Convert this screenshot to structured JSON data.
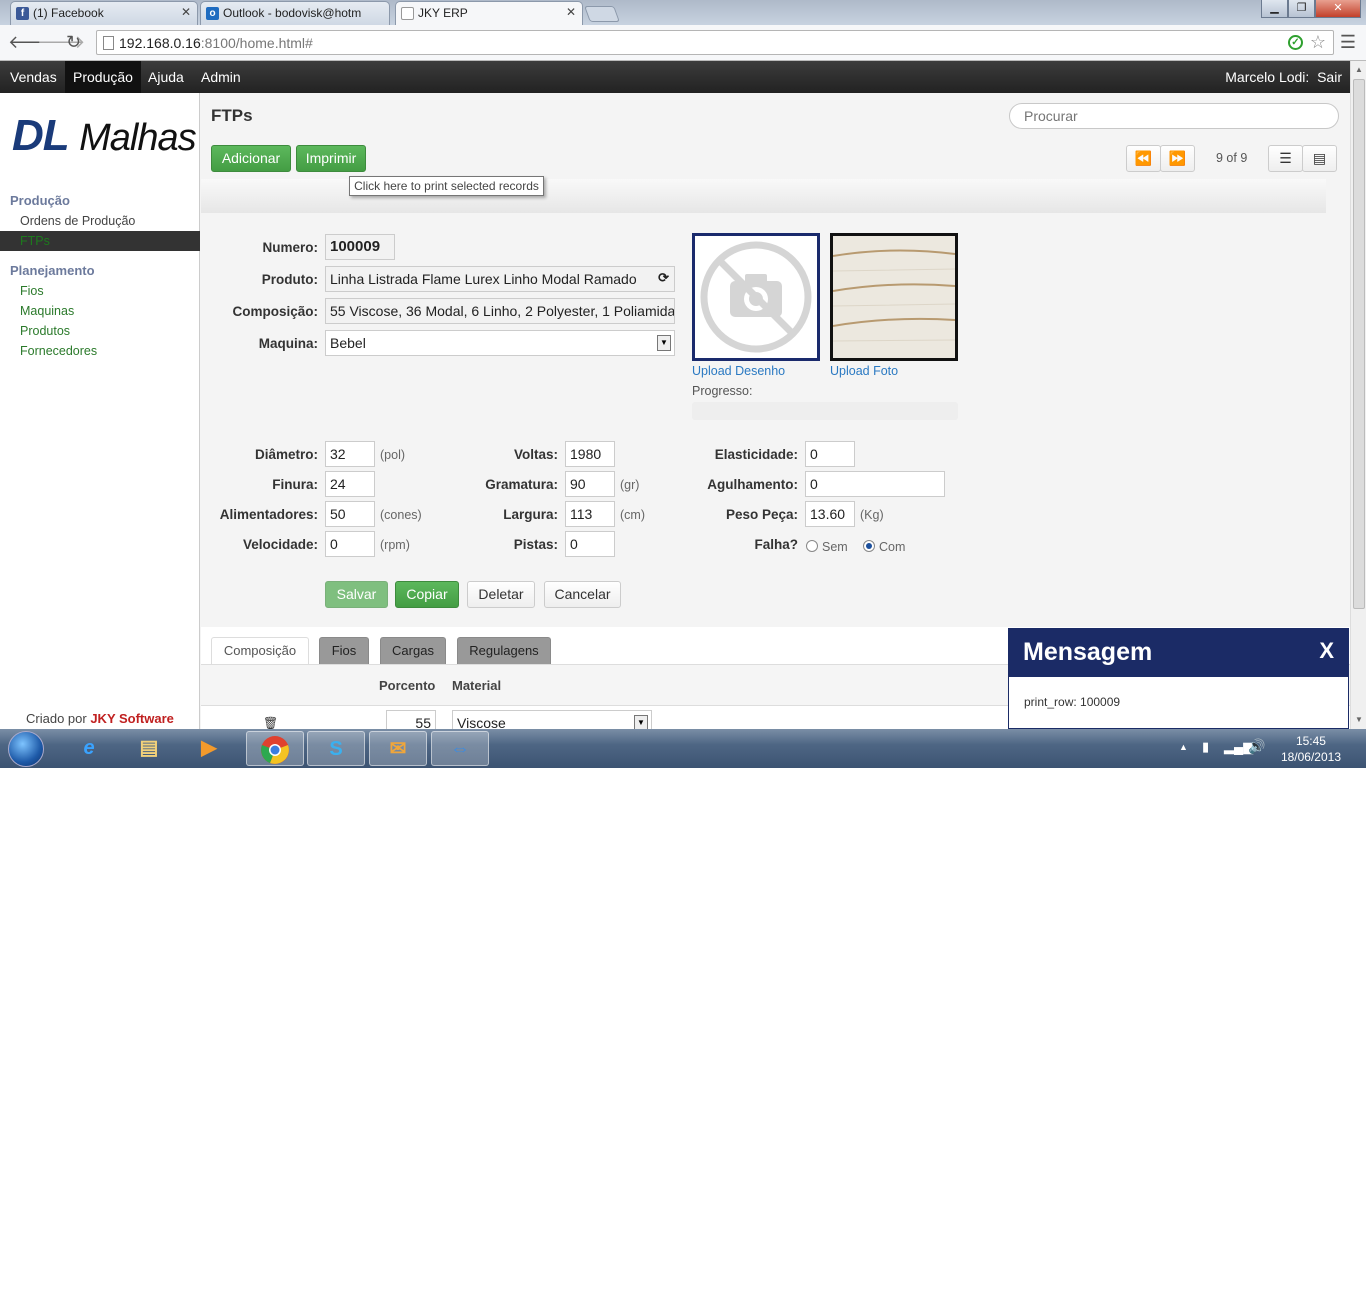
{
  "browser": {
    "tabs": [
      {
        "title": "(1) Facebook",
        "active": false
      },
      {
        "title": "Outlook - bodovisk@hotm",
        "active": false
      },
      {
        "title": "JKY ERP",
        "active": true
      }
    ],
    "url_host": "192.168.0.16",
    "url_rest": ":8100/home.html#"
  },
  "app_nav": {
    "menu": [
      "Vendas",
      "Produção",
      "Ajuda",
      "Admin"
    ],
    "active": "Produção",
    "user": "Marcelo Lodi:",
    "logout": "Sair"
  },
  "sidebar": {
    "logo_dl": "DL",
    "logo_malhas": "Malhas",
    "sections": [
      {
        "heading": "Produção",
        "items": [
          "Ordens de Produção",
          "FTPs"
        ]
      },
      {
        "heading": "Planejamento",
        "items": [
          "Fios",
          "Maquinas",
          "Produtos",
          "Fornecedores"
        ]
      }
    ],
    "active_item": "FTPs",
    "credit_prefix": "Criado por",
    "credit_brand": "JKY Software"
  },
  "page": {
    "title": "FTPs",
    "search_placeholder": "Procurar",
    "add_label": "Adicionar",
    "print_label": "Imprimir",
    "tooltip": "Click here to print selected records",
    "pager": "9 of 9"
  },
  "form": {
    "numero_label": "Numero:",
    "numero": "100009",
    "produto_label": "Produto:",
    "produto": "Linha Listrada Flame Lurex Linho Modal Ramado",
    "composicao_label": "Composição:",
    "composicao": "55 Viscose, 36 Modal, 6 Linho, 2 Polyester, 1 Poliamida",
    "maquina_label": "Maquina:",
    "maquina": "Bebel",
    "upload_desenho": "Upload Desenho",
    "upload_foto": "Upload Foto",
    "progresso_label": "Progresso:",
    "diametro_label": "Diâmetro:",
    "diametro": "32",
    "diametro_unit": "(pol)",
    "finura_label": "Finura:",
    "finura": "24",
    "alimentadores_label": "Alimentadores:",
    "alimentadores": "50",
    "alimentadores_unit": "(cones)",
    "velocidade_label": "Velocidade:",
    "velocidade": "0",
    "velocidade_unit": "(rpm)",
    "voltas_label": "Voltas:",
    "voltas": "1980",
    "gramatura_label": "Gramatura:",
    "gramatura": "90",
    "gramatura_unit": "(gr)",
    "largura_label": "Largura:",
    "largura": "113",
    "largura_unit": "(cm)",
    "pistas_label": "Pistas:",
    "pistas": "0",
    "elasticidade_label": "Elasticidade:",
    "elasticidade": "0",
    "agulhamento_label": "Agulhamento:",
    "agulhamento": "0",
    "peso_label": "Peso Peça:",
    "peso": "13.60",
    "peso_unit": "(Kg)",
    "falha_label": "Falha?",
    "falha_options": [
      "Sem",
      "Com"
    ],
    "falha_selected": "Com",
    "buttons": {
      "salvar": "Salvar",
      "copiar": "Copiar",
      "deletar": "Deletar",
      "cancelar": "Cancelar"
    }
  },
  "detail": {
    "tabs": [
      "Composição",
      "Fios",
      "Cargas",
      "Regulagens"
    ],
    "active_tab": "Composição",
    "columns": [
      "Porcento",
      "Material"
    ],
    "rows": [
      {
        "porcento": "55",
        "material": "Viscose"
      }
    ]
  },
  "message": {
    "title": "Mensagem",
    "close": "X",
    "body": "print_row: 100009"
  },
  "taskbar": {
    "time": "15:45",
    "date": "18/06/2013"
  }
}
